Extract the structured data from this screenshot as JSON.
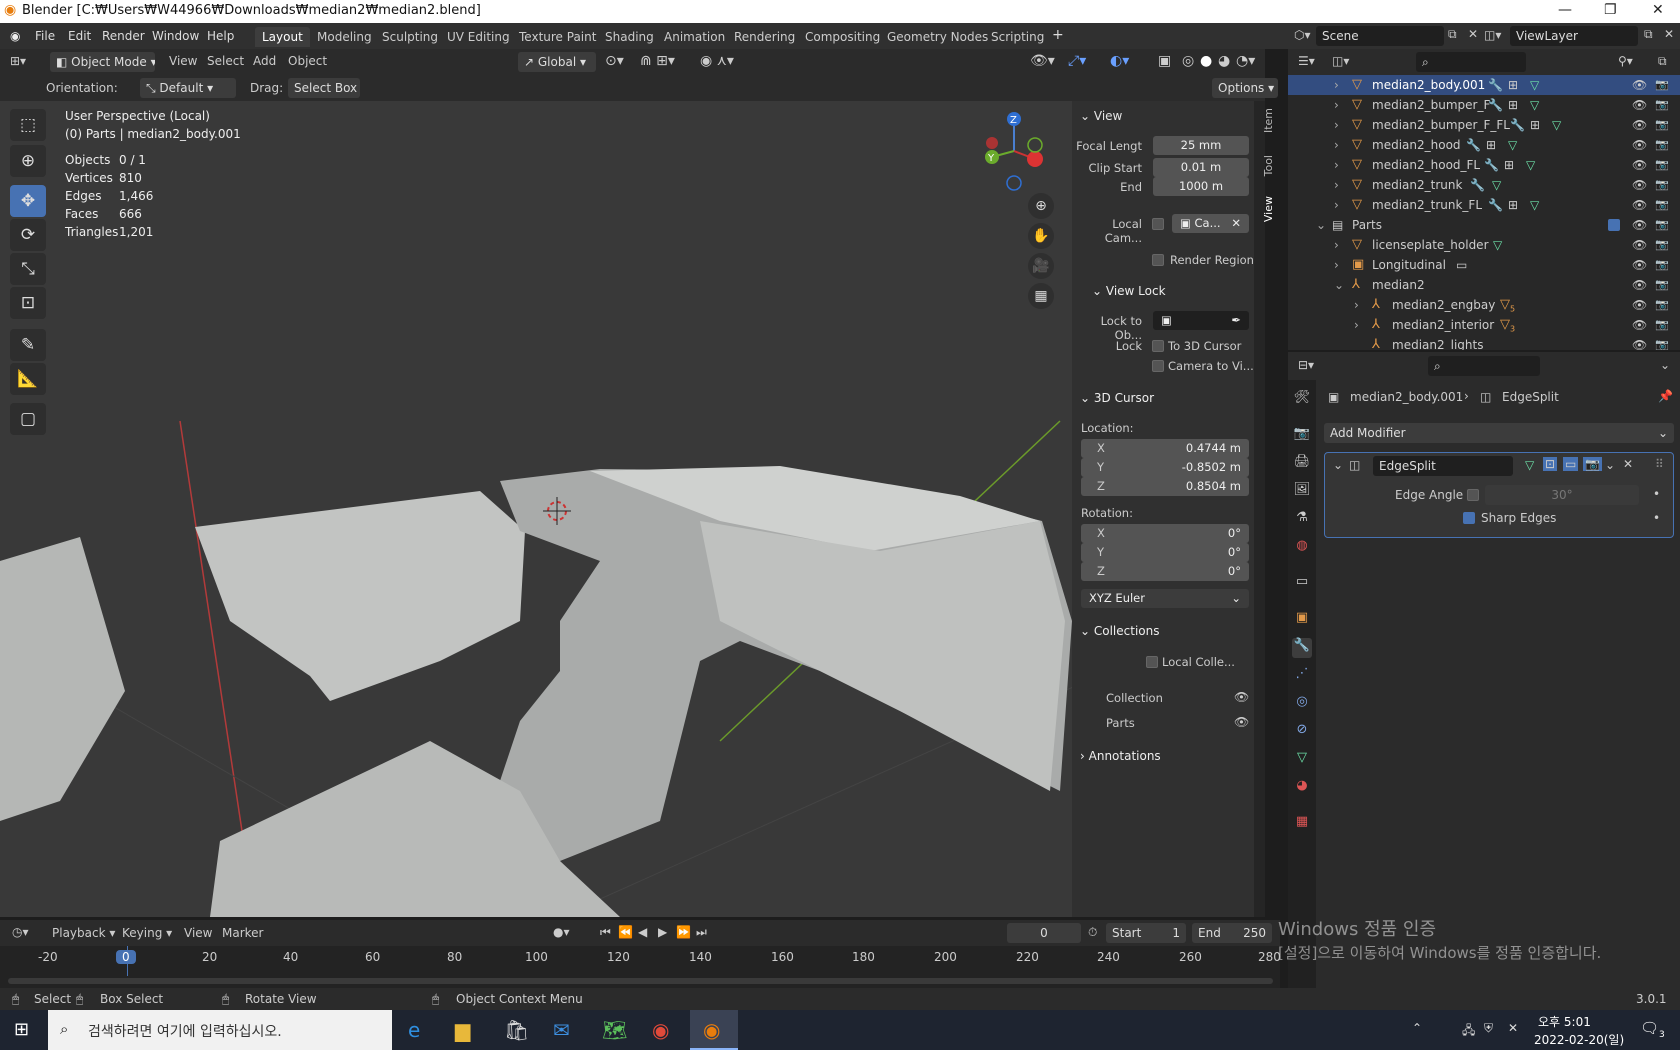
{
  "app": {
    "title": "Blender [C:₩Users₩W44966₩Downloads₩median2₩median2.blend]",
    "version": "3.0.1"
  },
  "menu": [
    "File",
    "Edit",
    "Render",
    "Window",
    "Help"
  ],
  "workspaces": [
    "Layout",
    "Modeling",
    "Sculpting",
    "UV Editing",
    "Texture Paint",
    "Shading",
    "Animation",
    "Rendering",
    "Compositing",
    "Geometry Nodes",
    "Scripting"
  ],
  "active_workspace": "Layout",
  "scene": {
    "name": "Scene",
    "viewlayer": "ViewLayer"
  },
  "viewport_header": {
    "mode": "Object Mode",
    "menus": [
      "View",
      "Select",
      "Add",
      "Object"
    ],
    "transform": "Global",
    "orientation_label": "Orientation:",
    "orientation": "Default",
    "drag_label": "Drag:",
    "drag": "Select Box",
    "options": "Options"
  },
  "overlay_text": {
    "perspective": "User Perspective (Local)",
    "collection": "(0) Parts | median2_body.001",
    "stats": [
      {
        "k": "Objects",
        "v": "0 / 1"
      },
      {
        "k": "Vertices",
        "v": "810"
      },
      {
        "k": "Edges",
        "v": "1,466"
      },
      {
        "k": "Faces",
        "v": "666"
      },
      {
        "k": "Triangles",
        "v": "1,201"
      }
    ]
  },
  "gizmo": {
    "z": "Z",
    "y": "Y"
  },
  "npanel": {
    "tabs": [
      "Item",
      "Tool",
      "View"
    ],
    "view": {
      "title": "View",
      "focal_label": "Focal Lengt",
      "focal": "25 mm",
      "clip_start_label": "Clip Start",
      "clip_start": "0.01 m",
      "end_label": "End",
      "end": "1000 m",
      "local_cam_label": "Local Cam...",
      "local_cam": "Ca...",
      "render_region": "Render Region"
    },
    "view_lock": {
      "title": "View Lock",
      "lock_obj_label": "Lock to Ob...",
      "lock_label": "Lock",
      "to_cursor": "To 3D Cursor",
      "camera_to_view": "Camera to Vi..."
    },
    "cursor": {
      "title": "3D Cursor",
      "location_label": "Location:",
      "x": "0.4744 m",
      "y": "-0.8502 m",
      "z": "0.8504 m",
      "rotation_label": "Rotation:",
      "rx": "0°",
      "ry": "0°",
      "rz": "0°",
      "mode": "XYZ Euler"
    },
    "collections": {
      "title": "Collections",
      "local": "Local Colle...",
      "items": [
        "Collection",
        "Parts"
      ]
    },
    "annotations": "Annotations"
  },
  "outliner": [
    {
      "name": "median2_body.001",
      "indent": 0,
      "selected": true
    },
    {
      "name": "median2_bumper_F",
      "indent": 0
    },
    {
      "name": "median2_bumper_F_FL",
      "indent": 0
    },
    {
      "name": "median2_hood",
      "indent": 0
    },
    {
      "name": "median2_hood_FL",
      "indent": 0
    },
    {
      "name": "median2_trunk",
      "indent": 0
    },
    {
      "name": "median2_trunk_FL",
      "indent": 0
    },
    {
      "name": "Parts",
      "indent": -1
    },
    {
      "name": "licenseplate_holder",
      "indent": 0
    },
    {
      "name": "Longitudinal",
      "indent": 0
    },
    {
      "name": "median2",
      "indent": 0
    },
    {
      "name": "median2_engbay",
      "indent": 1,
      "badge": "5"
    },
    {
      "name": "median2_interior",
      "indent": 1,
      "badge": "3"
    },
    {
      "name": "median2_lights",
      "indent": 1
    }
  ],
  "properties": {
    "breadcrumb_obj": "median2_body.001",
    "breadcrumb_mod": "EdgeSplit",
    "add_modifier": "Add Modifier",
    "modifier_name": "EdgeSplit",
    "edge_angle_label": "Edge Angle",
    "edge_angle": "30°",
    "sharp_edges": "Sharp Edges"
  },
  "timeline": {
    "menus": [
      "Playback",
      "Keying",
      "View",
      "Marker"
    ],
    "current": "0",
    "start_label": "Start",
    "start": "1",
    "end_label": "End",
    "end": "250",
    "ticks": [
      "-20",
      "0",
      "20",
      "40",
      "60",
      "80",
      "100",
      "120",
      "140",
      "160",
      "180",
      "200",
      "220",
      "240",
      "260",
      "280"
    ]
  },
  "statusbar": {
    "select": "Select",
    "box": "Box Select",
    "rotate": "Rotate View",
    "context": "Object Context Menu"
  },
  "watermark": {
    "line1": "Windows 정품 인증",
    "line2": "[설정]으로 이동하여 Windows를 정품 인증합니다."
  },
  "taskbar": {
    "search": "검색하려면 여기에 입력하십시오.",
    "time": "오후 5:01",
    "date": "2022-02-20(일)",
    "badge": "3"
  }
}
